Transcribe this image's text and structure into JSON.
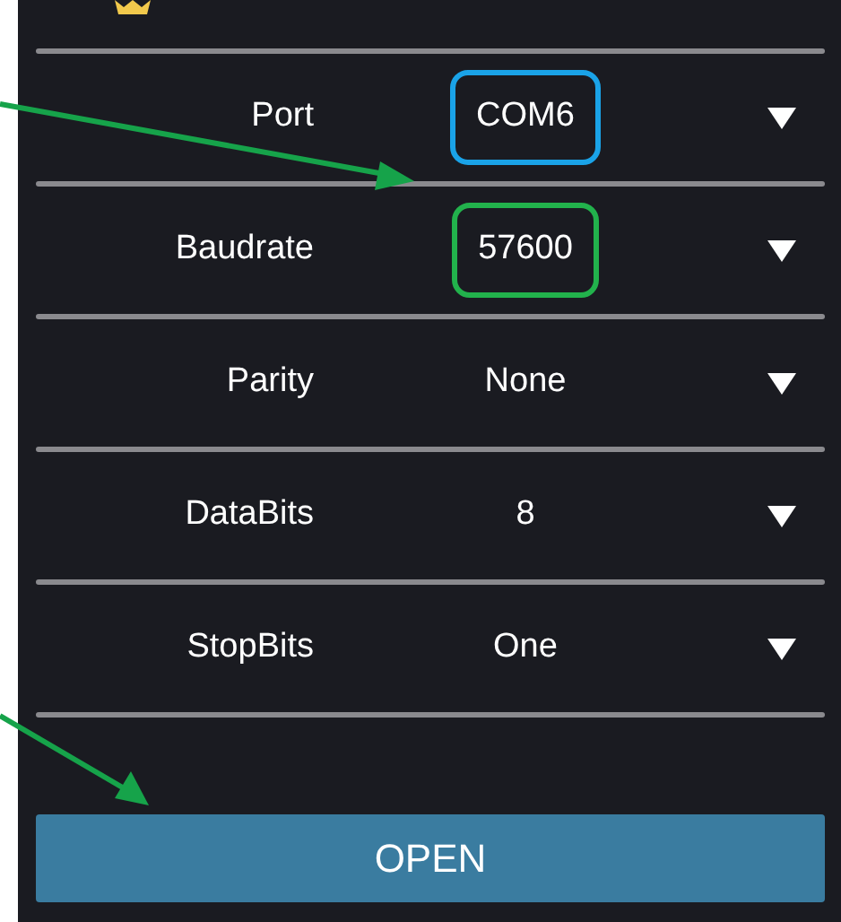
{
  "settings": [
    {
      "label": "Port",
      "value": "COM6",
      "color": "#1aa3e8"
    },
    {
      "label": "Baudrate",
      "value": "57600",
      "color": "#22b24c"
    },
    {
      "label": "Parity",
      "value": "None"
    },
    {
      "label": "DataBits",
      "value": "8"
    },
    {
      "label": "StopBits",
      "value": "One"
    }
  ],
  "open_button": {
    "label": "OPEN"
  }
}
